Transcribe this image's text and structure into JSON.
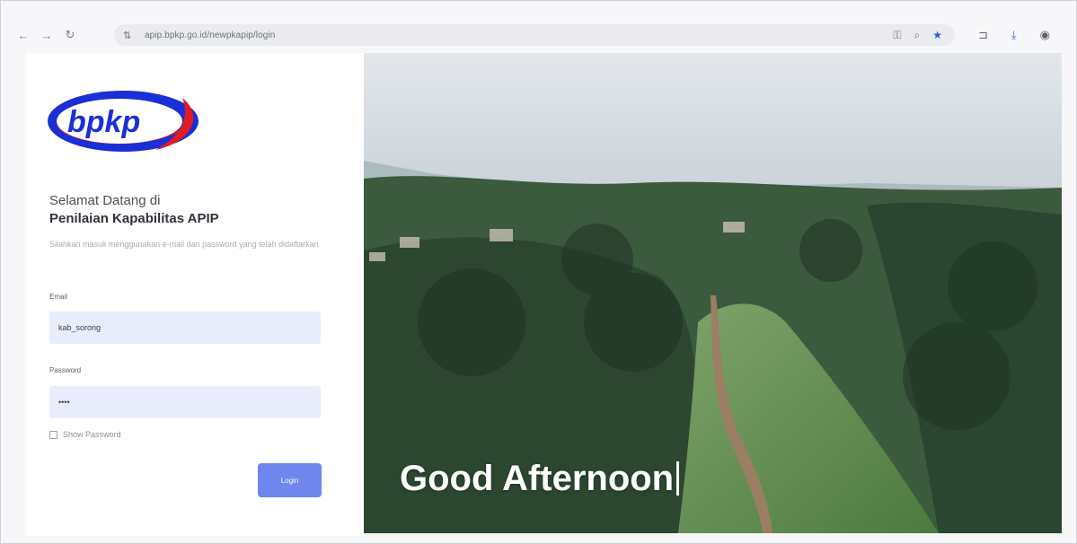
{
  "browser": {
    "url": "apip.bpkp.go.id/newpkapip/login"
  },
  "login": {
    "welcome": "Selamat Datang di",
    "app_title": "Penilaian Kapabilitas APIP",
    "instruction": "Silahkan masuk menggunakan e-mail dan password yang telah didaftarkan",
    "email_label": "Email",
    "email_value": "kab_sorong",
    "password_label": "Password",
    "password_value": "••••",
    "show_password_label": "Show Password",
    "login_button": "Login"
  },
  "logo": {
    "text": "bpkp",
    "colors": {
      "blue": "#1a2fd6",
      "red": "#e21b23"
    }
  },
  "hero": {
    "greeting": "Good Afternoon"
  },
  "colors": {
    "accent": "#6f86ee",
    "input_bg": "#e9edfb"
  }
}
